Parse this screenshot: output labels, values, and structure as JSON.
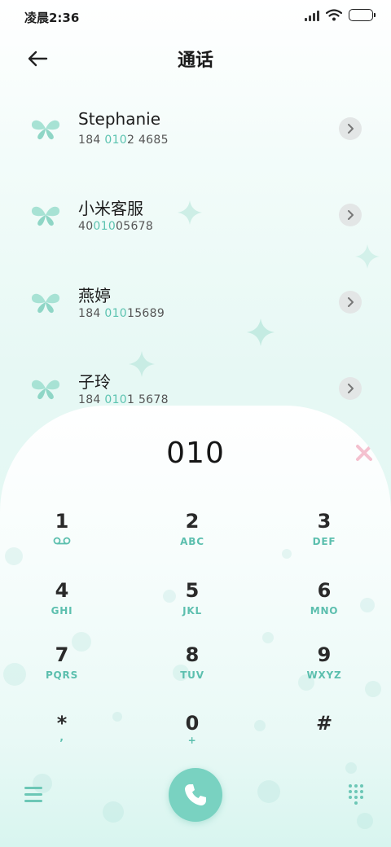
{
  "status_bar": {
    "time": "凌晨2:36",
    "battery_level": 1.0,
    "battery_color": "#86e7cf"
  },
  "header": {
    "title": "通话"
  },
  "accent_color": "#5cc3b0",
  "contacts": [
    {
      "name": "Stephanie",
      "number_pre": "184 ",
      "number_match": "010",
      "number_post": "2 4685"
    },
    {
      "name": "小米客服",
      "number_pre": "40",
      "number_match": "010",
      "number_post": "05678"
    },
    {
      "name": "燕婷",
      "number_pre": "184 ",
      "number_match": "010",
      "number_post": "15689"
    },
    {
      "name": "子玲",
      "number_pre": "184 ",
      "number_match": "010",
      "number_post": "1 5678"
    }
  ],
  "dialer": {
    "input": "010",
    "keys": [
      {
        "digit": "1",
        "sub": "",
        "icon": "voicemail-icon"
      },
      {
        "digit": "2",
        "sub": "ABC"
      },
      {
        "digit": "3",
        "sub": "DEF"
      },
      {
        "digit": "4",
        "sub": "GHI"
      },
      {
        "digit": "5",
        "sub": "JKL"
      },
      {
        "digit": "6",
        "sub": "MNO"
      },
      {
        "digit": "7",
        "sub": "PQRS"
      },
      {
        "digit": "8",
        "sub": "TUV"
      },
      {
        "digit": "9",
        "sub": "WXYZ"
      },
      {
        "digit": "*",
        "sub": ","
      },
      {
        "digit": "0",
        "sub": "+"
      },
      {
        "digit": "#",
        "sub": ""
      }
    ]
  },
  "icons": {
    "back": "arrow-left-icon",
    "avatar": "butterfly-icon",
    "detail": "chevron-right-icon",
    "clear": "delete-x-icon",
    "menu": "menu-icon",
    "call": "phone-icon",
    "keypad": "dialpad-icon"
  }
}
